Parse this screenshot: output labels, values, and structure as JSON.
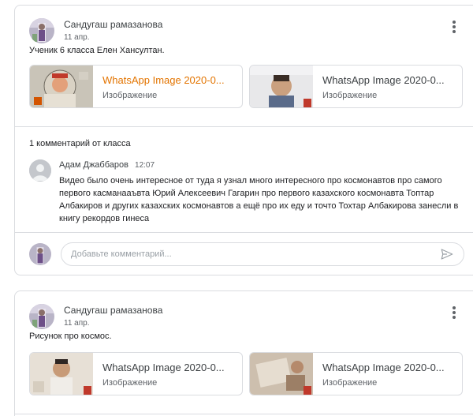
{
  "posts": [
    {
      "author": "Сандугаш рамазанова",
      "date": "11 апр.",
      "text": "Ученик 6 класса Елен Хансултан.",
      "attachments": [
        {
          "name": "WhatsApp Image 2020-0...",
          "type": "Изображение"
        },
        {
          "name": "WhatsApp Image 2020-0...",
          "type": "Изображение"
        }
      ],
      "comments_count": "1 комментарий от класса",
      "comment": {
        "author": "Адам Джаббаров",
        "time": "12:07",
        "text": "Видео было очень интересное от туда я узнал много интересного про космонавтов про самого первого касманааъвта Юрий Алексеевич Гагарин про первого казахского космонавта Топтар Албакиров и других казахских космонавтов а ещё про их еду и точто Тохтар Албакирова занесли в книгу рекордов гинеса"
      },
      "comment_placeholder": "Добавьте комментарий..."
    },
    {
      "author": "Сандугаш рамазанова",
      "date": "11 апр.",
      "text": "Рисунок про космос.",
      "attachments": [
        {
          "name": "WhatsApp Image 2020-0...",
          "type": "Изображение"
        },
        {
          "name": "WhatsApp Image 2020-0...",
          "type": "Изображение"
        }
      ]
    }
  ],
  "colors": {
    "accent": "#e37400",
    "border": "#dadce0",
    "text": "#3c4043",
    "secondary": "#5f6368"
  },
  "icons": {
    "more": "more-vert-icon",
    "send": "send-icon"
  }
}
